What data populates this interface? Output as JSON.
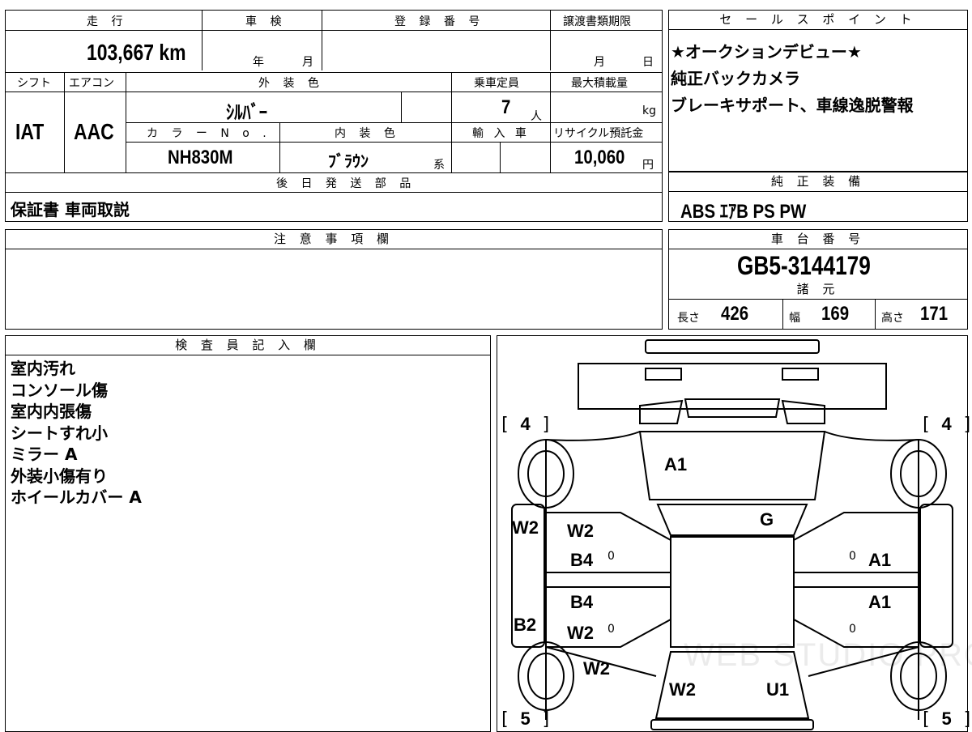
{
  "top_table": {
    "headers": {
      "mileage": "走 行",
      "inspection": "車 検",
      "registration": "登 録 番 号",
      "transfer_deadline": "譲渡書類期限",
      "shift": "シフト",
      "aircon": "エアコン",
      "exterior_color": "外 装 色",
      "capacity": "乗車定員",
      "max_load": "最大積載量",
      "color_no": "カ ラ ー N o .",
      "interior_color": "内 装 色",
      "import": "輸 入 車",
      "recycle": "リサイクル預託金",
      "later_parts": "後 日 発 送 部 品"
    },
    "mileage_value": "103,667 km",
    "inspection_year_unit": "年",
    "inspection_month_unit": "月",
    "transfer_month_unit": "月",
    "transfer_day_unit": "日",
    "shift_value": "IAT",
    "aircon_value": "AAC",
    "exterior_color_value": "ｼﾙﾊﾞｰ",
    "capacity_value": "7",
    "capacity_unit": "人",
    "max_load_unit": "kg",
    "color_no_value": "NH830M",
    "interior_color_value": "ﾌﾞﾗｳﾝ",
    "interior_color_suffix": "系",
    "recycle_value": "10,060",
    "recycle_unit": "円",
    "later_parts_value": "保証書 車両取説"
  },
  "sales_point": {
    "header": "セ ー ル ス ポ イ ン ト",
    "lines": [
      "★オークションデビュー★",
      "純正バックカメラ",
      "ブレーキサポート、車線逸脱警報"
    ]
  },
  "genuine_equipment": {
    "header": "純 正 装 備",
    "value": "ABS ｴｱB PS PW"
  },
  "notes": {
    "header": "注 意 事 項 欄",
    "value": ""
  },
  "chassis": {
    "header": "車 台 番 号",
    "value": "GB5-3144179",
    "specs_header": "諸 元",
    "length_label": "長さ",
    "length_value": "426",
    "width_label": "幅",
    "width_value": "169",
    "height_label": "高さ",
    "height_value": "171"
  },
  "inspector": {
    "header": "検 査 員 記 入 欄",
    "lines": [
      "室内汚れ",
      "コンソール傷",
      "室内内張傷",
      "シートすれ小",
      "ミラー A",
      "外装小傷有り",
      "ホイールカバー A"
    ]
  },
  "diagram": {
    "tire_front_left": "4",
    "tire_front_right": "4",
    "tire_rear_left": "5",
    "tire_rear_right": "5",
    "marks": {
      "hood": "A1",
      "windshield": "G",
      "left_fender": "W2",
      "left_front_door_top": "W2",
      "left_front_door_bottom": "B4",
      "left_rear_door_top": "B4",
      "left_rear_door_bottom": "W2",
      "left_rocker": "B2",
      "left_rear_quarter": "W2",
      "rear_left": "W2",
      "rear_right": "U1",
      "right_front_door": "A1",
      "right_rear_door": "A1"
    },
    "zero_marks": [
      "0",
      "0",
      "0",
      "0"
    ],
    "watermark": "WEB STUDIO PRO"
  }
}
